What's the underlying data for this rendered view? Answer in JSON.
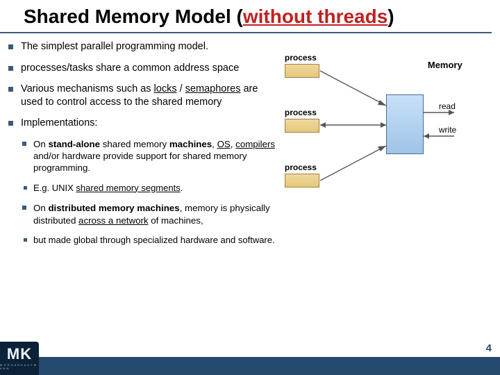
{
  "title": {
    "main": "Shared Memory Model (",
    "sub": "without threads",
    "close": ")"
  },
  "bullets": {
    "b1": "The simplest parallel programming model.",
    "b2": "processes/tasks share a common address space",
    "b3": "Various mechanisms such as <u>locks</u> / <u>semaphores</u> are used to control access to the shared memory",
    "b4": "Implementations:",
    "b4a": "On <b>stand-alone</b> shared memory <b>machines</b>, <u>OS</u>, <u>compilers</u> and/or hardware provide support for shared memory programming.",
    "b4a1": "E.g. UNIX <u>shared memory segments</u>.",
    "b4b": "On <b>distributed memory machines</b>, memory is physically distributed <u>across a network</u> of machines,",
    "b4b1": "but made global through specialized hardware and software."
  },
  "diagram": {
    "memory_label": "Memory",
    "proc_label": "process",
    "read_label": "read",
    "write_label": "write"
  },
  "footer": {
    "page": "4",
    "logo_main": "MK",
    "logo_sub": "M O R G A N  K A U F M A N N"
  }
}
